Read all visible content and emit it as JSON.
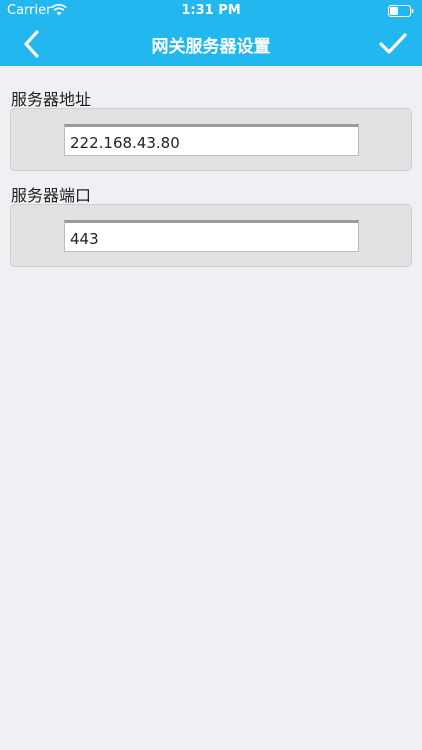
{
  "status_bar": {
    "carrier": "Carrier",
    "time": "1:31 PM",
    "icons": [
      "wifi-icon",
      "battery-icon"
    ]
  },
  "nav": {
    "title": "网关服务器设置",
    "back_icon": "chevron-left-icon",
    "confirm_icon": "checkmark-icon"
  },
  "form": {
    "server_address": {
      "label": "服务器地址",
      "value": "222.168.43.80"
    },
    "server_port": {
      "label": "服务器端口",
      "value": "443"
    }
  },
  "colors": {
    "header": "#22b8ef",
    "background": "#efeff4",
    "panel": "#e2e2e2"
  }
}
